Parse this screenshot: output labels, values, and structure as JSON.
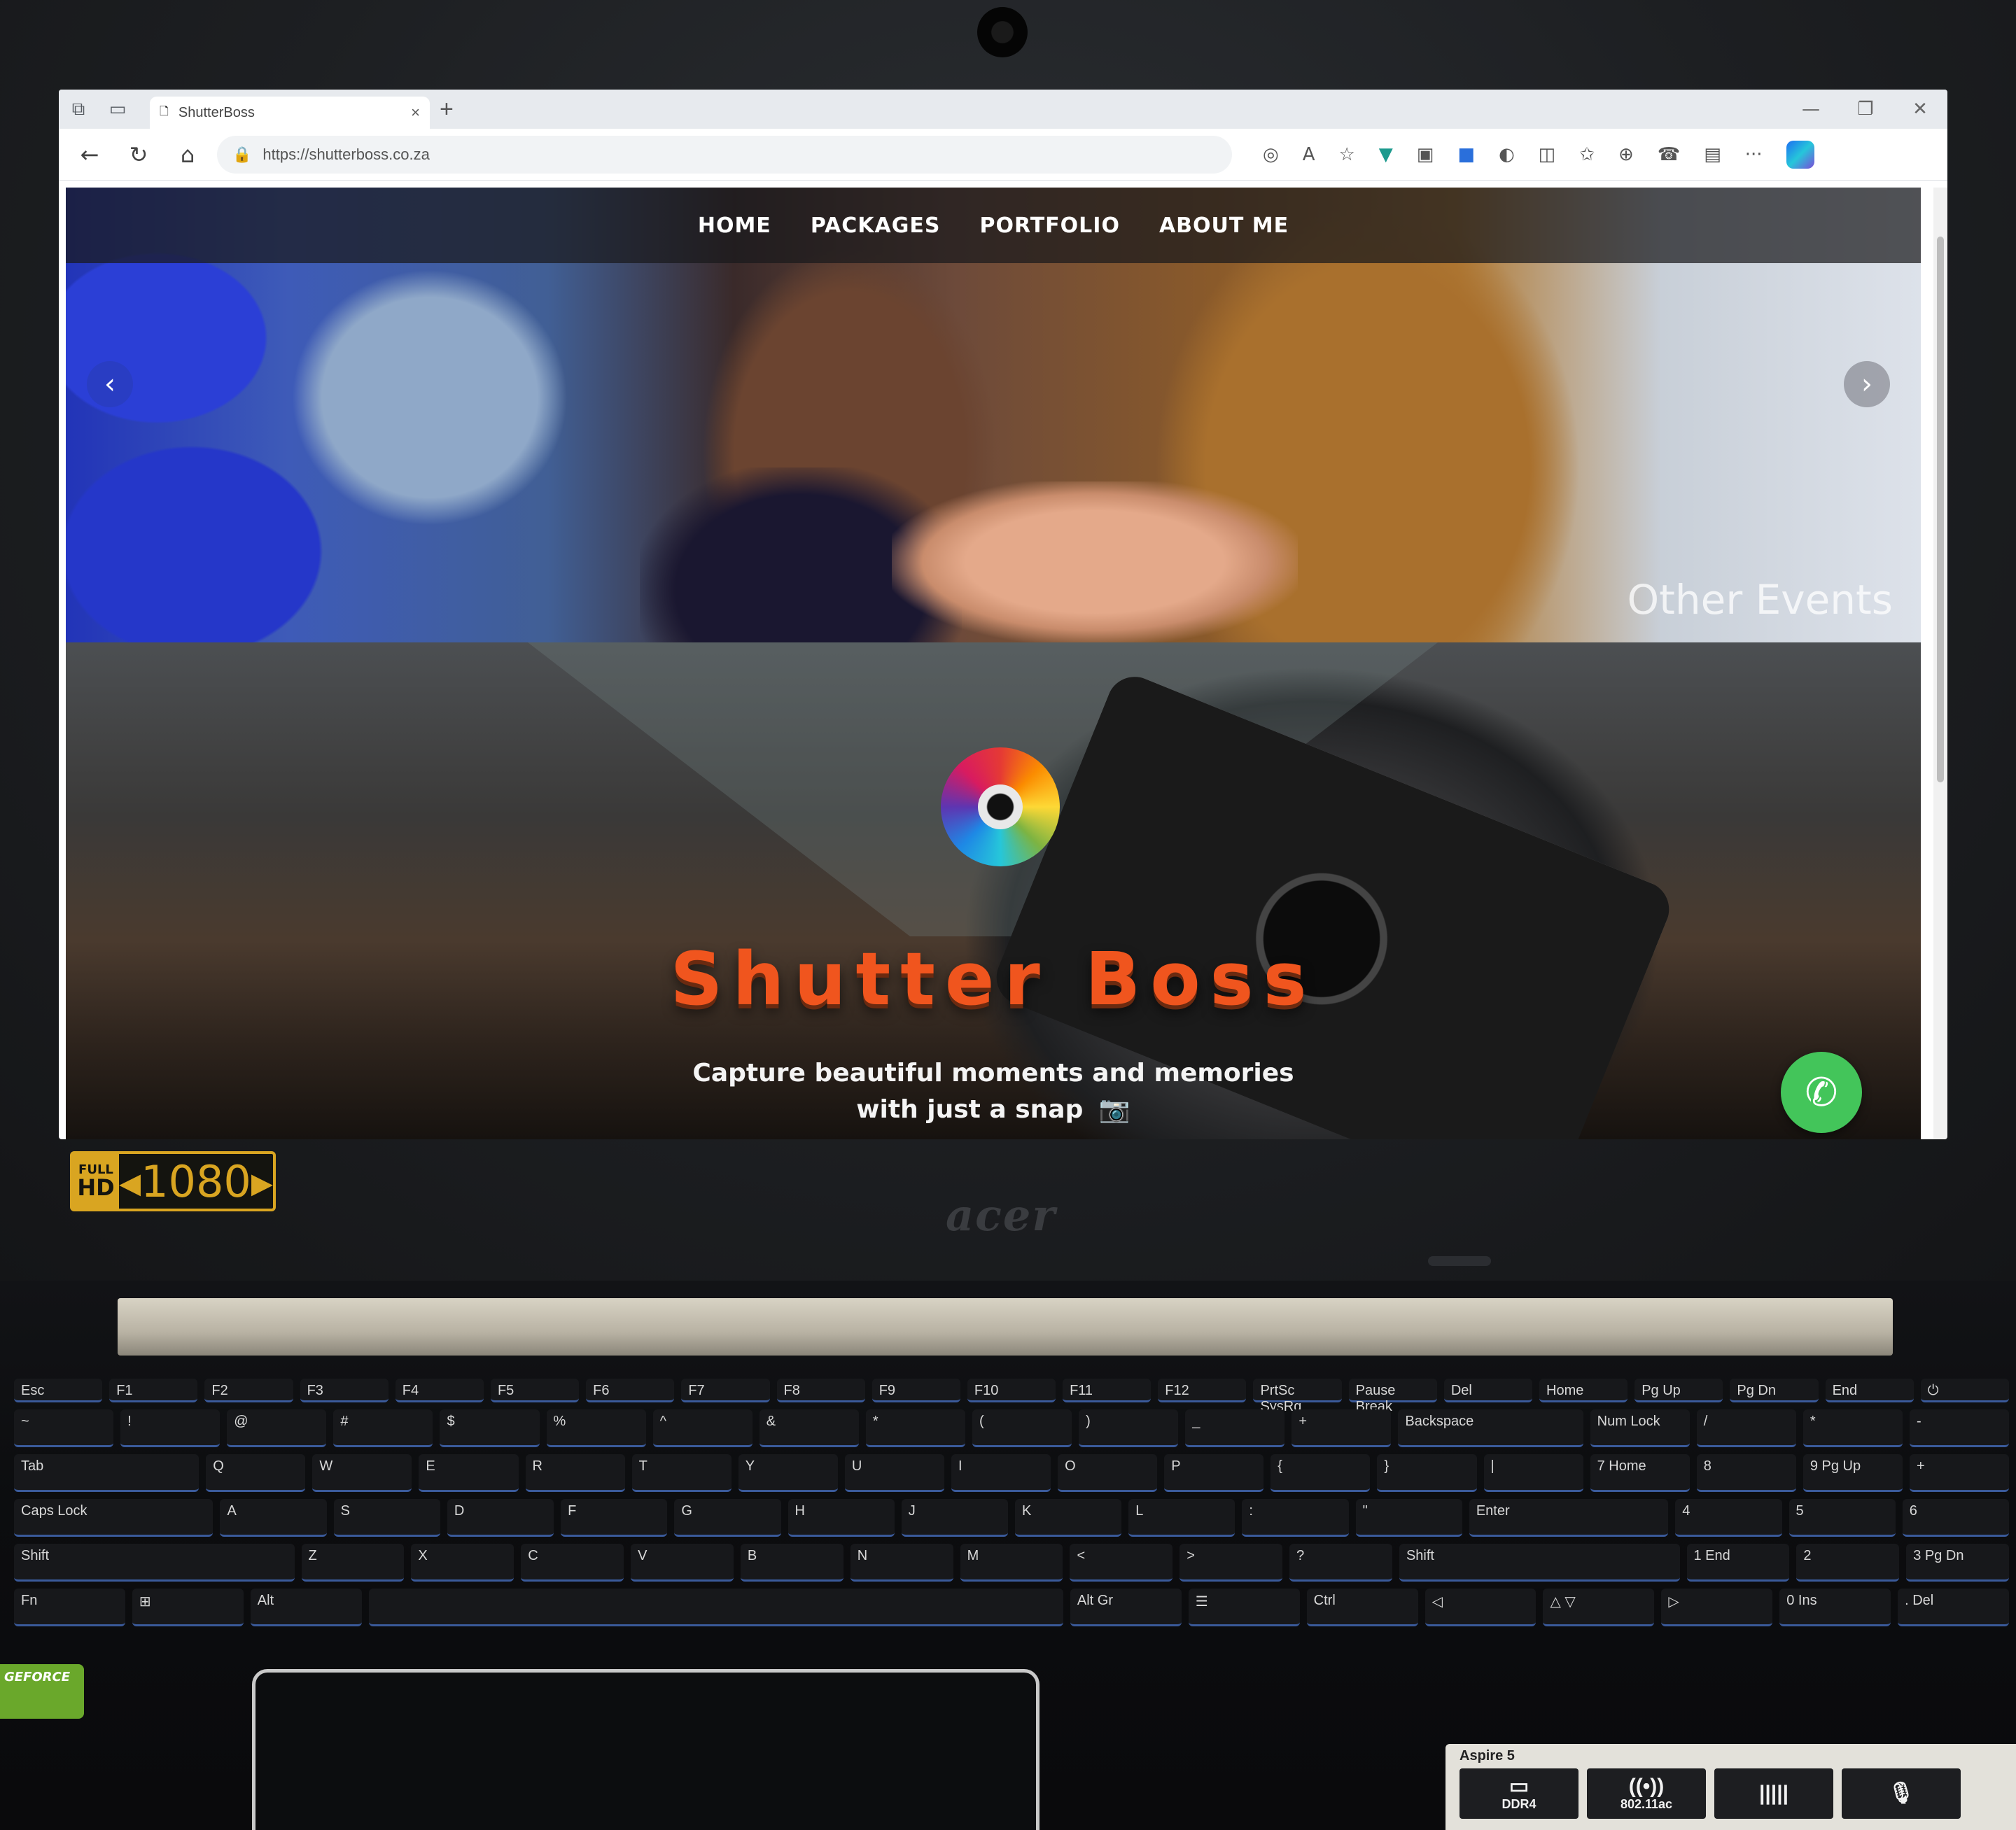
{
  "browser": {
    "tab_title": "ShutterBoss",
    "tab_close": "×",
    "new_tab": "+",
    "url": "https://shutterboss.co.za",
    "window_controls": {
      "minimize": "—",
      "maximize": "❐",
      "close": "✕"
    }
  },
  "site": {
    "nav": {
      "home": "HOME",
      "packages": "PACKAGES",
      "portfolio": "PORTFOLIO",
      "about": "ABOUT ME"
    },
    "carousel": {
      "prev": "‹",
      "next": "›",
      "caption": "Other Events"
    },
    "banner": {
      "title": "Shutter Boss",
      "tagline_line1": "Capture beautiful moments and memories",
      "tagline_line2": "with just a snap",
      "tagline_icon": "📷"
    },
    "whatsapp_icon": "✆"
  },
  "laptop": {
    "badge_full": "FULL",
    "badge_hd": "HD",
    "badge_resolution": "◂1080▸",
    "brand": "acer",
    "gpu_sticker": "GEFORCE",
    "spec_sticker": {
      "model": "Aspire 5",
      "items": [
        {
          "glyph": "▭",
          "label": "DDR4"
        },
        {
          "glyph": "((•))",
          "label": "802.11ac"
        },
        {
          "glyph": "|||||",
          "label": ""
        },
        {
          "glyph": "🎙",
          "label": ""
        }
      ]
    },
    "keyboard": {
      "row_fn": [
        "Esc",
        "F1",
        "F2",
        "F3",
        "F4",
        "F5",
        "F6",
        "F7",
        "F8",
        "F9",
        "F10",
        "F11",
        "F12",
        "PrtSc SysRq",
        "Pause Break",
        "Del",
        "Home",
        "Pg Up",
        "Pg Dn",
        "End",
        "⏻"
      ],
      "row_num": [
        "~",
        "!",
        "@",
        "#",
        "$",
        "%",
        "^",
        "&",
        "*",
        "(",
        ")",
        "_",
        "+",
        "Backspace",
        "Num Lock",
        "/",
        "*",
        "-"
      ],
      "row_q": [
        "Tab",
        "Q",
        "W",
        "E",
        "R",
        "T",
        "Y",
        "U",
        "I",
        "O",
        "P",
        "{",
        "}",
        "|",
        "7 Home",
        "8",
        "9 Pg Up",
        "+"
      ],
      "row_a": [
        "Caps Lock",
        "A",
        "S",
        "D",
        "F",
        "G",
        "H",
        "J",
        "K",
        "L",
        ":",
        "\"",
        "Enter",
        "4",
        "5",
        "6"
      ],
      "row_z": [
        "Shift",
        "Z",
        "X",
        "C",
        "V",
        "B",
        "N",
        "M",
        "<",
        ">",
        "?",
        "Shift",
        "1 End",
        "2",
        "3 Pg Dn"
      ],
      "row_space": [
        "Fn",
        "⊞",
        "Alt",
        "",
        "Alt Gr",
        "☰",
        "Ctrl",
        "◁",
        "△ ▽",
        "▷",
        "0 Ins",
        ". Del"
      ]
    }
  }
}
